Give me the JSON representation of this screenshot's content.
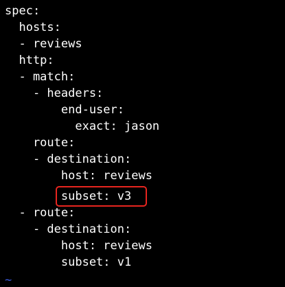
{
  "editor": {
    "lines": [
      "spec:",
      "  hosts:",
      "  - reviews",
      "  http:",
      "  - match:",
      "    - headers:",
      "        end-user:",
      "          exact: jason",
      "    route:",
      "    - destination:",
      "        host: reviews",
      "        subset: v3",
      "  - route:",
      "    - destination:",
      "        host: reviews",
      "        subset: v1"
    ],
    "empty_line_marker": "~",
    "highlighted_line_index": 11,
    "colors": {
      "background": "#000000",
      "text": "#ffffff",
      "highlight_border": "#e8251f",
      "tilde": "#3b5bdb"
    }
  }
}
